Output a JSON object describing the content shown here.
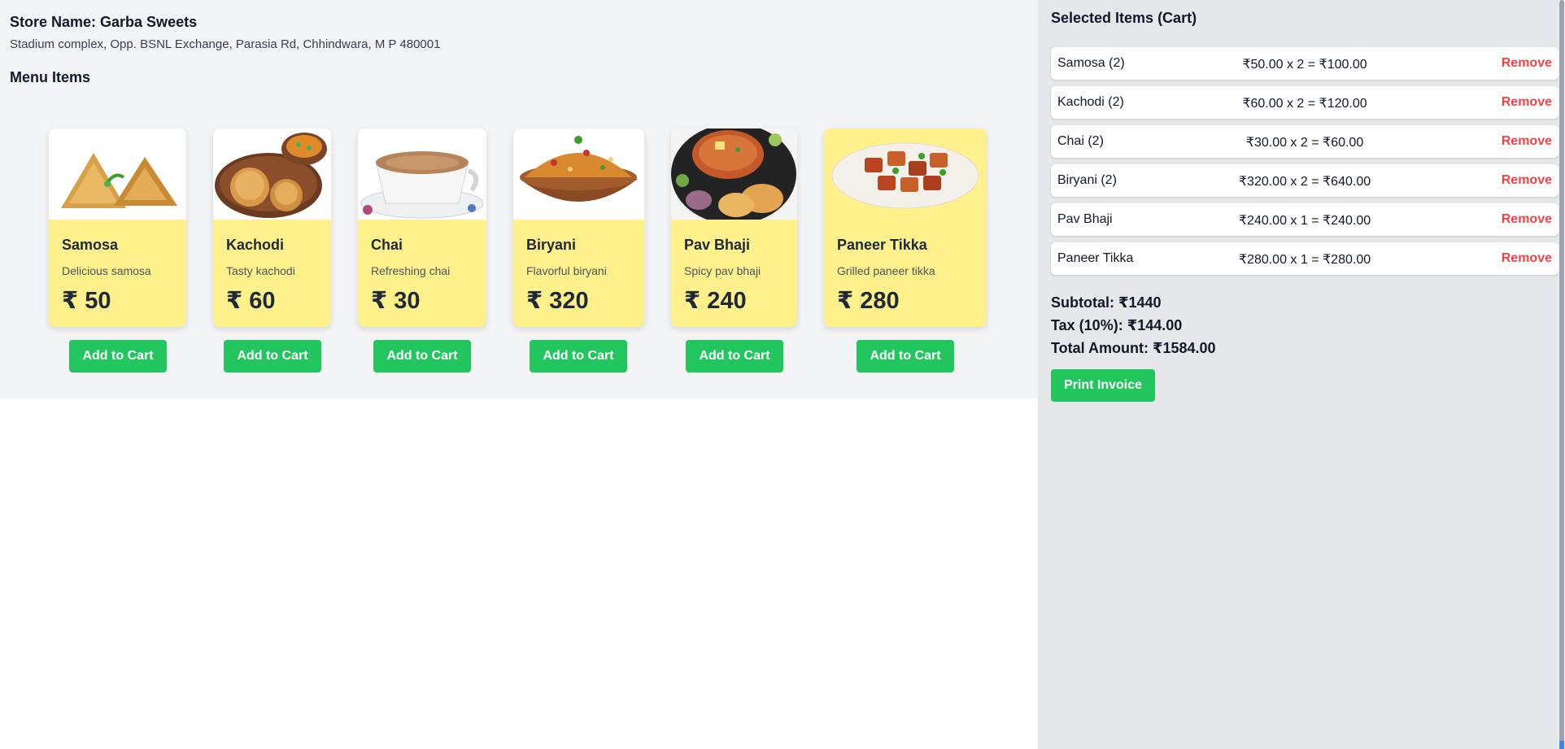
{
  "store": {
    "name_line": "Store Name: Garba Sweets",
    "address": "Stadium complex, Opp. BSNL Exchange, Parasia Rd, Chhindwara, M P 480001"
  },
  "menu": {
    "heading": "Menu Items",
    "add_label": "Add to Cart",
    "items": [
      {
        "name": "Samosa",
        "desc": "Delicious samosa",
        "price": "₹ 50",
        "icon": "samosa-image"
      },
      {
        "name": "Kachodi",
        "desc": "Tasty kachodi",
        "price": "₹ 60",
        "icon": "kachodi-image"
      },
      {
        "name": "Chai",
        "desc": "Refreshing chai",
        "price": "₹ 30",
        "icon": "chai-image"
      },
      {
        "name": "Biryani",
        "desc": "Flavorful biryani",
        "price": "₹ 320",
        "icon": "biryani-image"
      },
      {
        "name": "Pav Bhaji",
        "desc": "Spicy pav bhaji",
        "price": "₹ 240",
        "icon": "pav-bhaji-image"
      },
      {
        "name": "Paneer Tikka",
        "desc": "Grilled paneer tikka",
        "price": "₹ 280",
        "icon": "paneer-tikka-image"
      }
    ]
  },
  "cart": {
    "title": "Selected Items (Cart)",
    "remove_label": "Remove",
    "rows": [
      {
        "name": "Samosa (2)",
        "calc": "₹50.00 x 2 = ₹100.00"
      },
      {
        "name": "Kachodi (2)",
        "calc": "₹60.00 x 2 = ₹120.00"
      },
      {
        "name": "Chai (2)",
        "calc": "₹30.00 x 2 = ₹60.00"
      },
      {
        "name": "Biryani (2)",
        "calc": "₹320.00 x 2 = ₹640.00"
      },
      {
        "name": "Pav Bhaji",
        "calc": "₹240.00 x 1 = ₹240.00"
      },
      {
        "name": "Paneer Tikka",
        "calc": "₹280.00 x 1 = ₹280.00"
      }
    ],
    "subtotal": "Subtotal: ₹1440",
    "tax": "Tax (10%): ₹144.00",
    "total": "Total Amount: ₹1584.00",
    "print_label": "Print Invoice"
  },
  "colors": {
    "card_bg": "#fef08a",
    "button_green": "#22c55e",
    "remove_red": "#ef4444",
    "left_bg": "#f3f4f6",
    "cart_bg": "#e5e7eb"
  }
}
